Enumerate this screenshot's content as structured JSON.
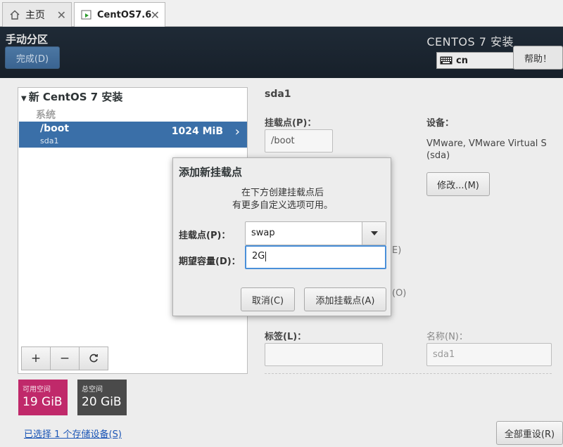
{
  "tabs": {
    "home_label": "主页",
    "vm_label": "CentOS7.6"
  },
  "header": {
    "title": "手动分区",
    "done_label": "完成(D)",
    "product_title": "CENTOS 7 安装",
    "keyboard_layout": "cn",
    "help_label": "帮助！",
    "background": "#1c2631"
  },
  "left_panel": {
    "install_title": "新 CentOS 7 安装",
    "system_label": "系统",
    "partition": {
      "mount_point": "/boot",
      "device": "sda1",
      "size": "1024 MiB"
    },
    "toolbar": {
      "add_icon": "plus-icon",
      "remove_icon": "minus-icon",
      "refresh_icon": "refresh-icon"
    }
  },
  "space": {
    "available_label": "可用空间",
    "available_value": "19 GiB",
    "available_color": "#c0296a",
    "total_label": "总空间",
    "total_value": "20 GiB",
    "total_color": "#4a4a4a"
  },
  "storage_link": "已选择 1 个存储设备(S)",
  "reset_label": "全部重设(R)",
  "details": {
    "title": "sda1",
    "mount_label": "挂载点(P)：",
    "mount_value": "/boot",
    "device_label": "设备：",
    "device_value": "VMware, VMware Virtual S (sda)",
    "modify_label": "修改...(M)",
    "ghost_e": "E)",
    "ghost_o": "(O)",
    "tag_label": "标签(L)：",
    "tag_value": "",
    "name_label": "名称(N)：",
    "name_value": "sda1"
  },
  "dialog": {
    "title": "添加新挂载点",
    "desc_line1": "在下方创建挂载点后",
    "desc_line2": "有更多自定义选项可用。",
    "mount_label": "挂载点(P)：",
    "mount_value": "swap",
    "capacity_label": "期望容量(D)：",
    "capacity_value": "2G",
    "cancel_label": "取消(C)",
    "add_label": "添加挂载点(A)"
  }
}
